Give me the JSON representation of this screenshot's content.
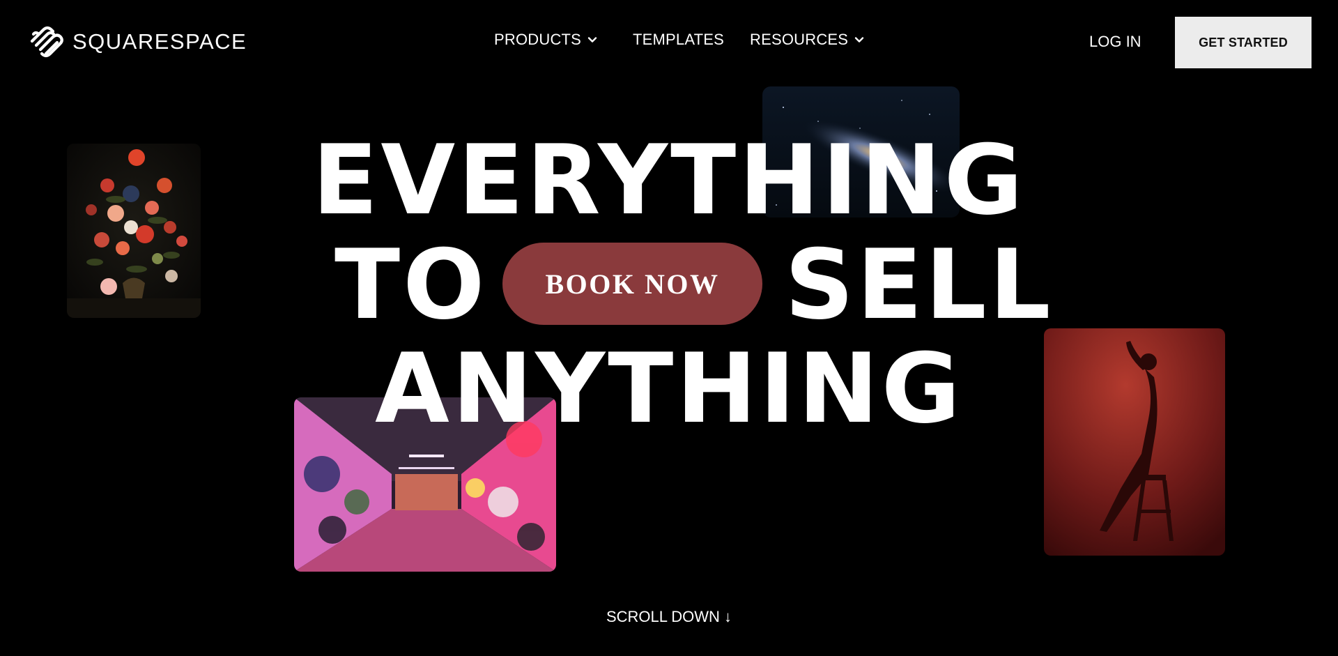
{
  "header": {
    "brand": "SQUARESPACE",
    "nav": {
      "products": "PRODUCTS",
      "templates": "TEMPLATES",
      "resources": "RESOURCES"
    },
    "login": "LOG IN",
    "get_started": "GET STARTED"
  },
  "hero": {
    "line1": "EVERYTHING",
    "line2_left": "TO",
    "line2_right": "SELL",
    "line3": "ANYTHING",
    "cta": "BOOK NOW"
  },
  "scroll": {
    "label": "SCROLL DOWN ↓"
  },
  "images": [
    {
      "name": "flower-still-life-painting"
    },
    {
      "name": "galaxy-night-sky"
    },
    {
      "name": "graffiti-tunnel"
    },
    {
      "name": "red-silhouette-portrait"
    }
  ],
  "colors": {
    "background": "#000000",
    "text": "#ffffff",
    "cta_button": "#8a3a3c",
    "get_started_bg": "#ececec"
  }
}
